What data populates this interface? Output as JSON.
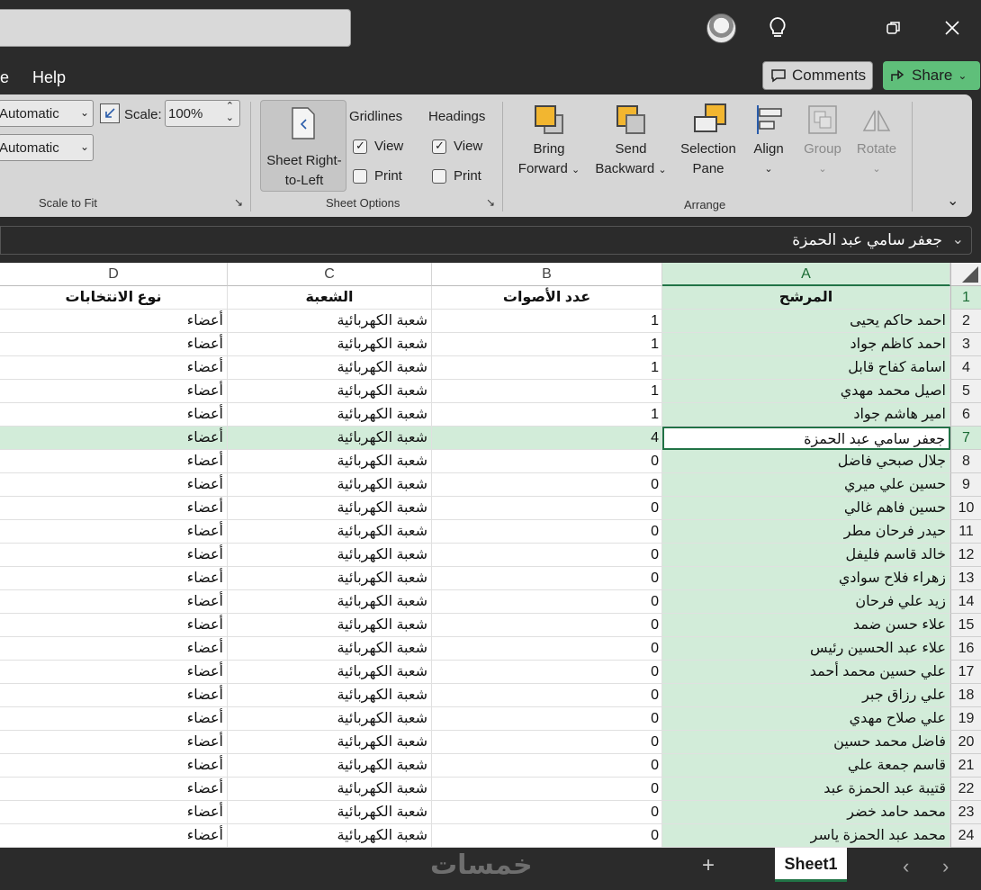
{
  "menu": {
    "partial": "e",
    "help": "Help"
  },
  "buttons": {
    "comments": "Comments",
    "share": "Share"
  },
  "ribbon": {
    "width_value": "Automatic",
    "height_value": "Automatic",
    "scale_label": "Scale:",
    "scale_value": "100%",
    "scale_to_fit": "Scale to Fit",
    "sheet_rtl_line1": "Sheet Right-",
    "sheet_rtl_line2": "to-Left",
    "gridlines": "Gridlines",
    "headings": "Headings",
    "view": "View",
    "print": "Print",
    "sheet_options": "Sheet Options",
    "bring_forward_1": "Bring",
    "bring_forward_2": "Forward",
    "send_backward_1": "Send",
    "send_backward_2": "Backward",
    "selection_pane_1": "Selection",
    "selection_pane_2": "Pane",
    "align": "Align",
    "group": "Group",
    "rotate": "Rotate",
    "arrange": "Arrange"
  },
  "formula_bar": {
    "value": "جعفر سامي عبد الحمزة"
  },
  "columns": [
    "D",
    "C",
    "B",
    "A"
  ],
  "header_row": {
    "A": "المرشح",
    "B": "عدد الأصوات",
    "C": "الشعبة",
    "D": "نوع الانتخابات"
  },
  "rows": [
    {
      "n": "2",
      "A": "احمد حاكم يحيى",
      "B": "1",
      "C": "شعبة الكهربائية",
      "D": "أعضاء"
    },
    {
      "n": "3",
      "A": "احمد كاظم جواد",
      "B": "1",
      "C": "شعبة الكهربائية",
      "D": "أعضاء"
    },
    {
      "n": "4",
      "A": "اسامة كفاح قابل",
      "B": "1",
      "C": "شعبة الكهربائية",
      "D": "أعضاء"
    },
    {
      "n": "5",
      "A": "اصيل محمد مهدي",
      "B": "1",
      "C": "شعبة الكهربائية",
      "D": "أعضاء"
    },
    {
      "n": "6",
      "A": "امير هاشم جواد",
      "B": "1",
      "C": "شعبة الكهربائية",
      "D": "أعضاء"
    },
    {
      "n": "7",
      "A": "جعفر سامي عبد الحمزة",
      "B": "4",
      "C": "شعبة الكهربائية",
      "D": "أعضاء"
    },
    {
      "n": "8",
      "A": "جلال صبحي فاضل",
      "B": "0",
      "C": "شعبة الكهربائية",
      "D": "أعضاء"
    },
    {
      "n": "9",
      "A": "حسين علي ميري",
      "B": "0",
      "C": "شعبة الكهربائية",
      "D": "أعضاء"
    },
    {
      "n": "10",
      "A": "حسين فاهم غالي",
      "B": "0",
      "C": "شعبة الكهربائية",
      "D": "أعضاء"
    },
    {
      "n": "11",
      "A": "حيدر فرحان مطر",
      "B": "0",
      "C": "شعبة الكهربائية",
      "D": "أعضاء"
    },
    {
      "n": "12",
      "A": "خالد قاسم فليفل",
      "B": "0",
      "C": "شعبة الكهربائية",
      "D": "أعضاء"
    },
    {
      "n": "13",
      "A": "زهراء فلاح سوادي",
      "B": "0",
      "C": "شعبة الكهربائية",
      "D": "أعضاء"
    },
    {
      "n": "14",
      "A": "زيد علي فرحان",
      "B": "0",
      "C": "شعبة الكهربائية",
      "D": "أعضاء"
    },
    {
      "n": "15",
      "A": "علاء حسن ضمد",
      "B": "0",
      "C": "شعبة الكهربائية",
      "D": "أعضاء"
    },
    {
      "n": "16",
      "A": "علاء عبد الحسين رئيس",
      "B": "0",
      "C": "شعبة الكهربائية",
      "D": "أعضاء"
    },
    {
      "n": "17",
      "A": "علي حسين محمد أحمد",
      "B": "0",
      "C": "شعبة الكهربائية",
      "D": "أعضاء"
    },
    {
      "n": "18",
      "A": "علي رزاق جبر",
      "B": "0",
      "C": "شعبة الكهربائية",
      "D": "أعضاء"
    },
    {
      "n": "19",
      "A": "علي صلاح مهدي",
      "B": "0",
      "C": "شعبة الكهربائية",
      "D": "أعضاء"
    },
    {
      "n": "20",
      "A": "فاضل محمد حسين",
      "B": "0",
      "C": "شعبة الكهربائية",
      "D": "أعضاء"
    },
    {
      "n": "21",
      "A": "قاسم جمعة علي",
      "B": "0",
      "C": "شعبة الكهربائية",
      "D": "أعضاء"
    },
    {
      "n": "22",
      "A": "قتيبة عبد الحمزة عبد",
      "B": "0",
      "C": "شعبة الكهربائية",
      "D": "أعضاء"
    },
    {
      "n": "23",
      "A": "محمد حامد خضر",
      "B": "0",
      "C": "شعبة الكهربائية",
      "D": "أعضاء"
    },
    {
      "n": "24",
      "A": "محمد عبد الحمزة ياسر",
      "B": "0",
      "C": "شعبة الكهربائية",
      "D": "أعضاء"
    }
  ],
  "selected_row": "7",
  "sheet_tab": "Sheet1",
  "watermark": "خمسات",
  "colors": {
    "accent": "#217346",
    "selection_fill": "#d2ecd9",
    "share_green": "#5fbf7a"
  }
}
